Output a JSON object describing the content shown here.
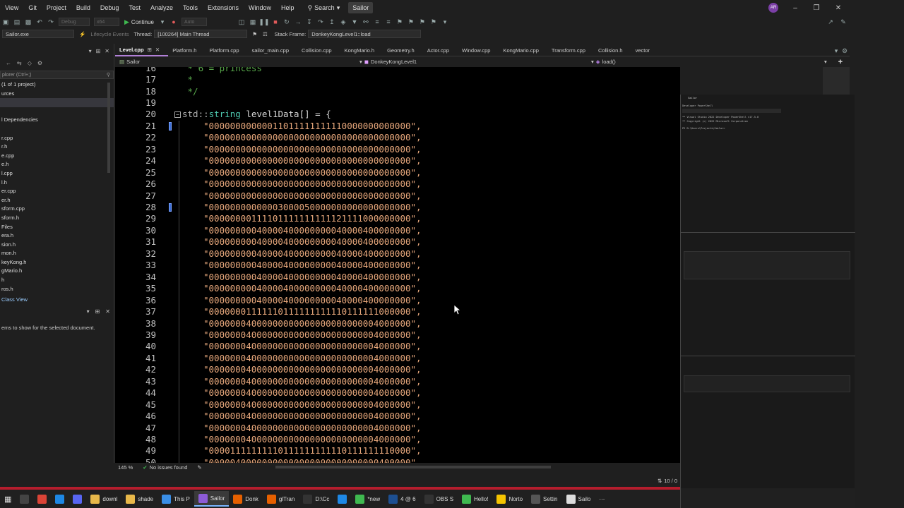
{
  "menu": {
    "items": [
      "View",
      "Git",
      "Project",
      "Build",
      "Debug",
      "Test",
      "Analyze",
      "Tools",
      "Extensions",
      "Window",
      "Help"
    ],
    "search_label": "Search",
    "solution_name": "Sailor",
    "avatar_initials": "AR"
  },
  "toolbar": {
    "continue_label": "Continue",
    "config_dd": "Debug",
    "platform_dd": "x64",
    "auto_dd": "Auto"
  },
  "debug_toolbar": {
    "process": "Sailor.exe",
    "lifecycle": "Lifecycle Events",
    "thread_label": "Thread:",
    "thread_value": "[100264] Main Thread",
    "stack_frame_label": "Stack Frame:",
    "stack_frame_value": "DonkeyKongLevel1::load"
  },
  "solution_explorer": {
    "search_placeholder": "plorer (Ctrl+;)",
    "items": [
      "(1 of 1 project)",
      "urces",
      "",
      "",
      "l Dependencies",
      "",
      "r.cpp",
      "r.h",
      "e.cpp",
      "e.h",
      "l.cpp",
      "l.h",
      "er.cpp",
      "er.h",
      "sform.cpp",
      "sform.h",
      " Files",
      "era.h",
      "sion.h",
      "mon.h",
      "keyKong.h",
      "gMario.h",
      "h",
      "ros.h"
    ],
    "class_view_tab": "Class View",
    "props_message": "ems to show for the selected document."
  },
  "tabs": [
    {
      "label": "Level.cpp",
      "active": true
    },
    {
      "label": "Platform.h"
    },
    {
      "label": "Platform.cpp"
    },
    {
      "label": "sailor_main.cpp"
    },
    {
      "label": "Collision.cpp"
    },
    {
      "label": "KongMario.h"
    },
    {
      "label": "Geometry.h"
    },
    {
      "label": "Actor.cpp"
    },
    {
      "label": "Window.cpp"
    },
    {
      "label": "KongMario.cpp"
    },
    {
      "label": "Transform.cpp"
    },
    {
      "label": "Collision.h"
    },
    {
      "label": "vector"
    }
  ],
  "navbar": {
    "project": "Sailor",
    "scope": "DonkeyKongLevel1",
    "member": "load()"
  },
  "editor": {
    "lines": [
      {
        "n": "16",
        "t": " * 6 = princess",
        "kind": "cmt"
      },
      {
        "n": "17",
        "t": " *",
        "kind": "cmt"
      },
      {
        "n": "18",
        "t": " */",
        "kind": "cmt"
      },
      {
        "n": "19",
        "t": "",
        "kind": "plain"
      },
      {
        "n": "20",
        "t": "std::string level1Data[] = {",
        "kind": "decl"
      },
      {
        "n": "21",
        "t": "\"00000000000011011111111110000000000000\",",
        "kind": "str",
        "mark": true
      },
      {
        "n": "22",
        "t": "\"00000000000000000000000000000000000000\",",
        "kind": "str"
      },
      {
        "n": "23",
        "t": "\"00000000000000000000000000000000000000\",",
        "kind": "str"
      },
      {
        "n": "24",
        "t": "\"00000000000000000000000000000000000000\",",
        "kind": "str"
      },
      {
        "n": "25",
        "t": "\"00000000000000000000000000000000000000\",",
        "kind": "str"
      },
      {
        "n": "26",
        "t": "\"00000000000000000000000000000000000000\",",
        "kind": "str"
      },
      {
        "n": "27",
        "t": "\"00000000000000000000000000000000000000\",",
        "kind": "str"
      },
      {
        "n": "28",
        "t": "\"00000000000003000050000000000000000000\",",
        "kind": "str",
        "mark": true
      },
      {
        "n": "29",
        "t": "\"00000000111101111111111121111000000000\",",
        "kind": "str"
      },
      {
        "n": "30",
        "t": "\"00000000040000400000000040000400000000\",",
        "kind": "str"
      },
      {
        "n": "31",
        "t": "\"00000000040000400000000040000400000000\",",
        "kind": "str"
      },
      {
        "n": "32",
        "t": "\"00000000040000400000000040000400000000\",",
        "kind": "str"
      },
      {
        "n": "33",
        "t": "\"00000000040000400000000040000400000000\",",
        "kind": "str"
      },
      {
        "n": "34",
        "t": "\"00000000040000400000000040000400000000\",",
        "kind": "str"
      },
      {
        "n": "35",
        "t": "\"00000000040000400000000040000400000000\",",
        "kind": "str"
      },
      {
        "n": "36",
        "t": "\"00000000040000400000000040000400000000\",",
        "kind": "str"
      },
      {
        "n": "37",
        "t": "\"00000001111110111111111110111111000000\",",
        "kind": "str"
      },
      {
        "n": "38",
        "t": "\"00000004000000000000000000000004000000\",",
        "kind": "str"
      },
      {
        "n": "39",
        "t": "\"00000004000000000000000000000004000000\",",
        "kind": "str"
      },
      {
        "n": "40",
        "t": "\"00000004000000000000000000000004000000\",",
        "kind": "str"
      },
      {
        "n": "41",
        "t": "\"00000004000000000000000000000004000000\",",
        "kind": "str"
      },
      {
        "n": "42",
        "t": "\"00000004000000000000000000000004000000\",",
        "kind": "str"
      },
      {
        "n": "43",
        "t": "\"00000004000000000000000000000004000000\",",
        "kind": "str"
      },
      {
        "n": "44",
        "t": "\"00000004000000000000000000000004000000\",",
        "kind": "str"
      },
      {
        "n": "45",
        "t": "\"00000004000000000000000000000004000000\",",
        "kind": "str"
      },
      {
        "n": "46",
        "t": "\"00000004000000000000000000000004000000\",",
        "kind": "str"
      },
      {
        "n": "47",
        "t": "\"00000004000000000000000000000004000000\",",
        "kind": "str"
      },
      {
        "n": "48",
        "t": "\"00000004000000000000000000000004000000\",",
        "kind": "str"
      },
      {
        "n": "49",
        "t": "\"00001111111110111111111110111111110000\",",
        "kind": "str"
      },
      {
        "n": "50",
        "t": "\"00000400000000000000000000000000400000\",",
        "kind": "str"
      }
    ]
  },
  "status": {
    "zoom": "145 %",
    "issues": "No issues found",
    "line_col": "10 / 0"
  },
  "taskbar": [
    {
      "label": "",
      "icon": "terminal-icon",
      "color": "#444"
    },
    {
      "label": "",
      "icon": "chrome-icon",
      "color": "#db4437"
    },
    {
      "label": "",
      "icon": "edge-icon",
      "color": "#1e88e5"
    },
    {
      "label": "",
      "icon": "discord-icon",
      "color": "#5865f2"
    },
    {
      "label": "downl",
      "icon": "folder-icon",
      "color": "#e8b84a"
    },
    {
      "label": "shade",
      "icon": "folder-icon",
      "color": "#e8b84a"
    },
    {
      "label": "This P",
      "icon": "monitor-icon",
      "color": "#3a8ee6"
    },
    {
      "label": "Sailor",
      "icon": "visual-studio-icon",
      "color": "#8c5bd6",
      "active": true
    },
    {
      "label": "Donk",
      "icon": "firefox-icon",
      "color": "#e66000"
    },
    {
      "label": "glTran",
      "icon": "firefox-icon",
      "color": "#e66000"
    },
    {
      "label": "D:\\Cc",
      "icon": "cmd-icon",
      "color": "#333"
    },
    {
      "label": "",
      "icon": "vscode-icon",
      "color": "#1e88e5"
    },
    {
      "label": "*new",
      "icon": "notepad-icon",
      "color": "#3fb950"
    },
    {
      "label": "4 @ 6",
      "icon": "photoshop-icon",
      "color": "#1d4f91"
    },
    {
      "label": "OBS S",
      "icon": "obs-icon",
      "color": "#333"
    },
    {
      "label": "Hello!",
      "icon": "tool-icon",
      "color": "#3fb950"
    },
    {
      "label": "Norto",
      "icon": "norton-icon",
      "color": "#f5c400"
    },
    {
      "label": "Settin",
      "icon": "gear-icon",
      "color": "#555"
    },
    {
      "label": "Sailo",
      "icon": "window-icon",
      "color": "#ddd"
    }
  ],
  "mini_window": {
    "title": "Sailor",
    "lines": [
      "Developer PowerShell",
      "** Visual Studio 2022 Developer PowerShell v17.5.0",
      "** Copyright (c) 2022 Microsoft Corporation",
      "PS D:\\Users\\Projects\\Sailor>"
    ]
  }
}
